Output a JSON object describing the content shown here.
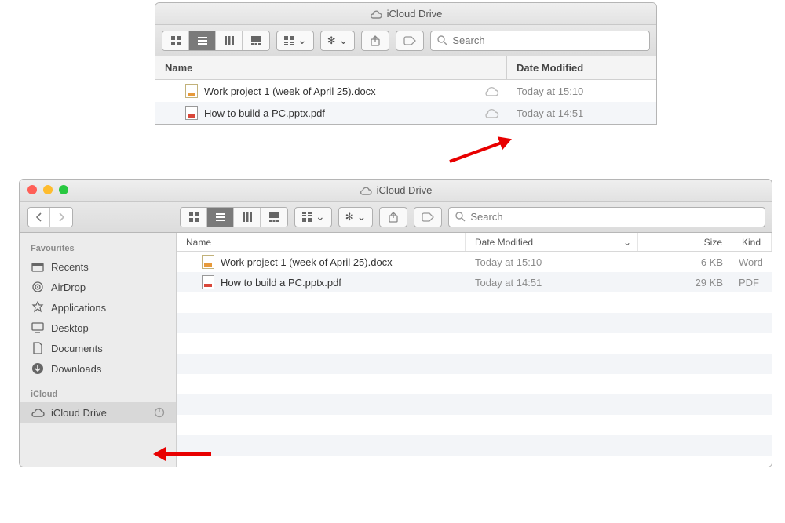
{
  "top_window": {
    "title": "iCloud Drive",
    "search_placeholder": "Search",
    "columns": {
      "name": "Name",
      "date": "Date Modified"
    },
    "files": [
      {
        "name": "Work project 1 (week of April 25).docx",
        "date": "Today at 15:10",
        "type": "docx"
      },
      {
        "name": "How to build a PC.pptx.pdf",
        "date": "Today at 14:51",
        "type": "pdf"
      }
    ]
  },
  "finder": {
    "title": "iCloud Drive",
    "search_placeholder": "Search",
    "sidebar": {
      "favourites_label": "Favourites",
      "icloud_label": "iCloud",
      "favourites": [
        {
          "label": "Recents",
          "icon": "clock"
        },
        {
          "label": "AirDrop",
          "icon": "airdrop"
        },
        {
          "label": "Applications",
          "icon": "apps"
        },
        {
          "label": "Desktop",
          "icon": "desktop"
        },
        {
          "label": "Documents",
          "icon": "doc"
        },
        {
          "label": "Downloads",
          "icon": "download"
        }
      ],
      "icloud_items": [
        {
          "label": "iCloud Drive",
          "icon": "cloud",
          "selected": true,
          "syncing": true
        }
      ]
    },
    "columns": {
      "name": "Name",
      "date": "Date Modified",
      "size": "Size",
      "kind": "Kind"
    },
    "files": [
      {
        "name": "Work project 1 (week of April 25).docx",
        "date": "Today at 15:10",
        "size": "6 KB",
        "kind": "Word",
        "type": "docx"
      },
      {
        "name": "How to build a PC.pptx.pdf",
        "date": "Today at 14:51",
        "size": "29 KB",
        "kind": "PDF",
        "type": "pdf"
      }
    ]
  }
}
